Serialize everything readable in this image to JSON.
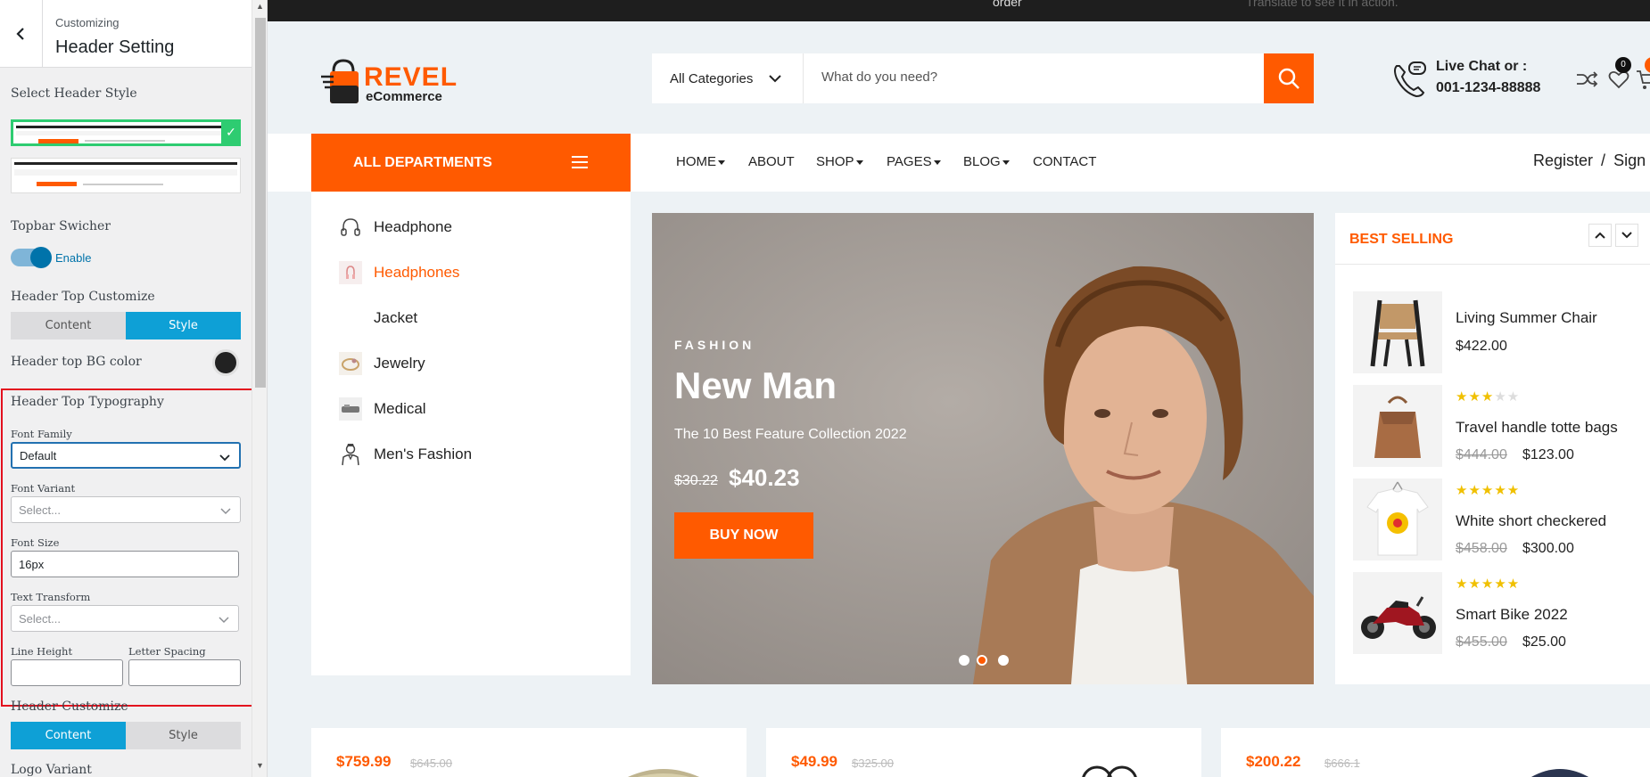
{
  "customizer": {
    "breadcrumb": "Customizing",
    "title": "Header Setting",
    "select_header_style": "Select Header Style",
    "topbar_switcher": "Topbar Swicher",
    "toggle_label": "Enable",
    "header_top_customize": "Header Top Customize",
    "seg1": {
      "content": "Content",
      "style": "Style",
      "active": "Style"
    },
    "header_top_bg_color": "Header top BG color",
    "bg_color_value": "#222222",
    "header_top_typography": "Header Top Typography",
    "font_family_label": "Font Family",
    "font_family_value": "Default",
    "font_variant_label": "Font Variant",
    "font_variant_placeholder": "Select...",
    "font_size_label": "Font Size",
    "font_size_value": "16px",
    "text_transform_label": "Text Transform",
    "text_transform_placeholder": "Select...",
    "line_height_label": "Line Height",
    "letter_spacing_label": "Letter Spacing",
    "header_customize": "Header Customize",
    "seg2": {
      "content": "Content",
      "style": "Style",
      "active": "Content"
    },
    "logo_variant": "Logo Variant"
  },
  "site": {
    "topbar": {
      "msg1": "order",
      "msg2": "Translate to see it in action."
    },
    "logo": {
      "name": "REVEL",
      "sub": "eCommerce"
    },
    "search": {
      "category": "All Categories",
      "placeholder": "What do you need?"
    },
    "contact": {
      "line1": "Live Chat or :",
      "line2": "001-1234-88888"
    },
    "wishlist_count": "0",
    "nav": {
      "departments": "ALL DEPARTMENTS",
      "items": [
        "HOME",
        "ABOUT",
        "SHOP",
        "PAGES",
        "BLOG",
        "CONTACT"
      ],
      "register": "Register",
      "separator": "/",
      "signin": "Sign in"
    },
    "departments": [
      {
        "label": "Headphone",
        "icon": "headphone-icon"
      },
      {
        "label": "Headphones",
        "icon": "headphones-thumb-icon",
        "active": true
      },
      {
        "label": "Jacket",
        "icon": ""
      },
      {
        "label": "Jewelry",
        "icon": "jewelry-icon"
      },
      {
        "label": "Medical",
        "icon": "medical-icon"
      },
      {
        "label": "Men's Fashion",
        "icon": "mens-fashion-icon"
      }
    ],
    "hero": {
      "category": "FASHION",
      "title": "New Man",
      "subtitle": "The 10 Best Feature Collection 2022",
      "old_price": "$30.22",
      "price": "$40.23",
      "button": "BUY NOW"
    },
    "best_selling": {
      "title": "BEST SELLING",
      "items": [
        {
          "name": "Living Summer Chair",
          "old_price": "",
          "price": "$422.00",
          "rating": 0
        },
        {
          "name": "Travel handle totte bags",
          "old_price": "$444.00",
          "price": "$123.00",
          "rating": 3
        },
        {
          "name": "White short checkered",
          "old_price": "$458.00",
          "price": "$300.00",
          "rating": 5
        },
        {
          "name": "Smart Bike 2022",
          "old_price": "$455.00",
          "price": "$25.00",
          "rating": 5
        }
      ]
    },
    "products": [
      {
        "price": "$759.99",
        "old_price": "$645.00"
      },
      {
        "price": "$49.99",
        "old_price": "$325.00"
      },
      {
        "price": "$200.22",
        "old_price": "$666.1"
      }
    ],
    "colors": {
      "accent": "#ff5a00",
      "topbar": "#1e1e1e",
      "customizer_blue": "#0ea0d6",
      "highlight_red": "#e3101e"
    }
  }
}
